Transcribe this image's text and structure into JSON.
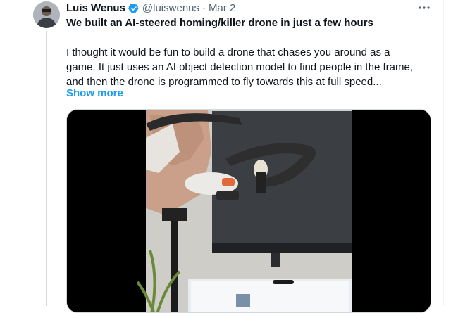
{
  "tweet": {
    "author_name": "Luis Wenus",
    "handle": "@luiswenus",
    "separator": "·",
    "date": "Mar 2",
    "title": "We built an AI-steered homing/killer drone in just a few hours",
    "body_lines": [
      "I thought it would be fun to build a drone that chases you around as a",
      "game. It just uses an AI object detection model to find people in the frame,",
      "and then the drone is programmed to fly towards this at full speed..."
    ],
    "show_more_label": "Show more",
    "more_icon": "more-horizontal-icon",
    "verified_icon": "verified-badge-icon"
  },
  "colors": {
    "link": "#1d9bf0",
    "secondary_text": "#536471",
    "verified": "#1d9bf0"
  }
}
